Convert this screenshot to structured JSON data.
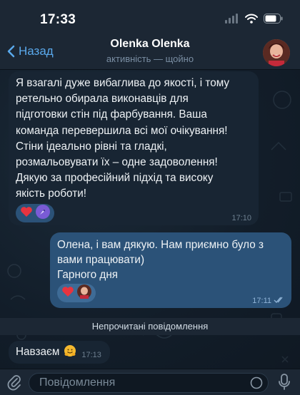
{
  "status_bar": {
    "time": "17:33"
  },
  "header": {
    "back_label": "Назад",
    "title": "Olenka Olenka",
    "subtitle": "активність — щойно"
  },
  "messages": [
    {
      "direction": "incoming",
      "text": "Я взагалі дуже вибаглива до якості, і тому\nретельно обирала виконавців для\nпідготовки стін під фарбування.  Ваша\nкоманда перевершила всі мої очікування!\n Стіни ідеально рівні та гладкі,\nрозмальовувати їх – одне задоволення!\n Дякую за професійний підхід та високу\nякість роботи!",
      "time": "17:10",
      "reactions": [
        "heart",
        "rocket-avatar"
      ]
    },
    {
      "direction": "outgoing",
      "text": "Олена, і вам дякую. Нам приємно було з\nвами працювати)\nГарного дня",
      "time": "17:11",
      "reactions": [
        "heart",
        "woman-avatar"
      ]
    },
    {
      "direction": "incoming",
      "text": "Навзаєм",
      "emoji": "🤗",
      "time": "17:13"
    }
  ],
  "unread_divider": "Непрочитані повідомлення",
  "input": {
    "placeholder": "Повідомлення"
  },
  "colors": {
    "background": "#0e1621",
    "bar": "#1c2734",
    "incoming_bubble": "#182533",
    "outgoing_bubble": "#2b5278",
    "accent": "#5aa9ec",
    "heart": "#e8343f"
  },
  "icons": [
    "wifi-icon",
    "battery-icon",
    "signal-icon",
    "chevron-left-icon",
    "paperclip-icon",
    "sticker-icon",
    "microphone-icon",
    "double-check-icon",
    "heart-icon"
  ]
}
